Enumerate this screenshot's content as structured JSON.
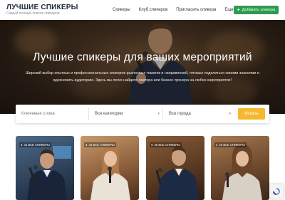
{
  "header": {
    "brand_title": "ЛУЧШИЕ СПИКЕРЫ",
    "brand_subtitle": "Самый полный список спикеров",
    "nav": [
      {
        "label": "Спикеры"
      },
      {
        "label": "Клуб спикеров"
      },
      {
        "label": "Пригласить спикера"
      },
      {
        "label": "Еще"
      }
    ],
    "add_button_label": "Добавить спикера"
  },
  "hero": {
    "title": "Лучшие спикеры для ваших мероприятий",
    "description": "Широкий выбор опытных и профессиональных спикеров различных тематик и направлений, готовых поделиться своими знаниями и вдохновить аудиторию. Здесь вы легко найдете лектора или бизнес-тренера на любое мероприятие!"
  },
  "search": {
    "keywords_placeholder": "Ключевые слова",
    "category_value": "Все категории",
    "city_value": "Все города",
    "button_label": "Искать"
  },
  "cards": [
    {
      "tag": "32 ВСЕ СПИКЕРЫ"
    },
    {
      "tag": "34 ВСЕ СПИКЕРЫ"
    },
    {
      "tag": "36 ВСЕ СПИКЕРЫ"
    },
    {
      "tag": "26 ВСЕ СПИКЕРЫ"
    }
  ],
  "colors": {
    "accent_green": "#2e9b4f",
    "search_button": "#f5b82e",
    "brand_text": "#1e2a38"
  }
}
